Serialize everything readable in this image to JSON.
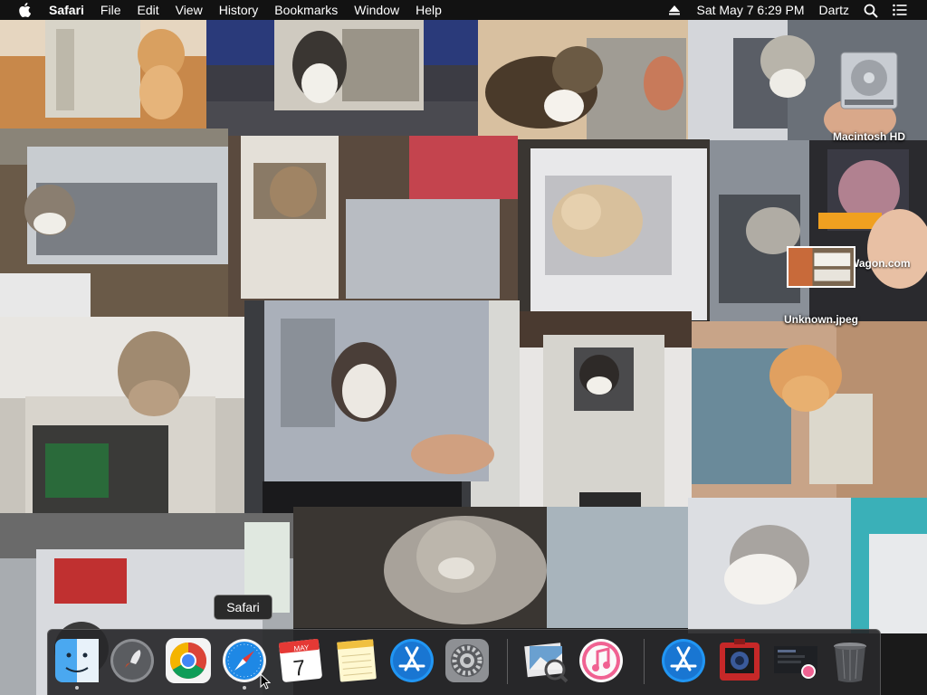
{
  "menubar": {
    "app_name": "Safari",
    "menus": [
      "File",
      "Edit",
      "View",
      "History",
      "Bookmarks",
      "Window",
      "Help"
    ],
    "icons": {
      "apple": "apple-logo-icon",
      "eject": "eject-icon",
      "search": "spotlight-search-icon",
      "notifications": "notification-center-icon"
    },
    "clock": "Sat May 7  6:29 PM",
    "user": "Dartz"
  },
  "desktop": {
    "icons": [
      {
        "label": "Macintosh HD",
        "icon": "hard-drive-icon"
      },
      {
        "label": "Unknown.jpeg",
        "icon": "image-file-icon"
      }
    ],
    "partial_label": "Wagon.com",
    "wallpaper": "collage of cats sitting inside computer cases"
  },
  "dock": {
    "tooltip": "Safari",
    "apps": [
      {
        "name": "Finder",
        "icon": "finder-icon",
        "running": true
      },
      {
        "name": "Launchpad",
        "icon": "launchpad-rocket-icon",
        "running": false
      },
      {
        "name": "Google Chrome",
        "icon": "chrome-icon",
        "running": false
      },
      {
        "name": "Safari",
        "icon": "safari-compass-icon",
        "running": true
      },
      {
        "name": "Calendar",
        "icon": "calendar-icon",
        "running": false,
        "month": "MAY",
        "day": "7"
      },
      {
        "name": "Notes",
        "icon": "notes-icon",
        "running": false
      },
      {
        "name": "App Store",
        "icon": "app-store-icon",
        "running": false
      },
      {
        "name": "System Preferences",
        "icon": "system-preferences-gear-icon",
        "running": false
      },
      {
        "name": "Preview",
        "icon": "preview-icon",
        "running": false
      },
      {
        "name": "iTunes",
        "icon": "itunes-icon",
        "running": false
      },
      {
        "name": "App Store Downloads",
        "icon": "app-store-icon",
        "running": false
      },
      {
        "name": "Photo Booth",
        "icon": "photo-booth-icon",
        "running": false
      },
      {
        "name": "Downloads Stack",
        "icon": "downloads-stack-icon",
        "running": false
      },
      {
        "name": "Trash",
        "icon": "trash-icon",
        "running": false
      }
    ]
  },
  "colors": {
    "menubar_bg": "#121212",
    "dock_bg": "#28282a",
    "safari_blue": "#1e88e5"
  }
}
